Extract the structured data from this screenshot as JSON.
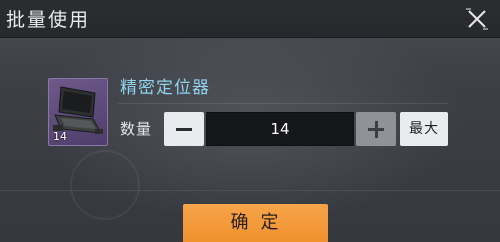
{
  "dialog": {
    "title": "批量使用",
    "close_icon": "close-x-icon"
  },
  "item": {
    "name": "精密定位器",
    "count": "14",
    "icon": "laptop-device-icon",
    "frame_color": "#5e4a7b"
  },
  "quantity": {
    "label": "数量",
    "value": "14",
    "minus_icon": "minus-icon",
    "plus_icon": "plus-icon",
    "max_label": "最大"
  },
  "actions": {
    "confirm_label": "确定",
    "confirm_color": "#f39a38"
  },
  "colors": {
    "item_name": "#8fd3ee",
    "title_text": "#e9eaec"
  }
}
